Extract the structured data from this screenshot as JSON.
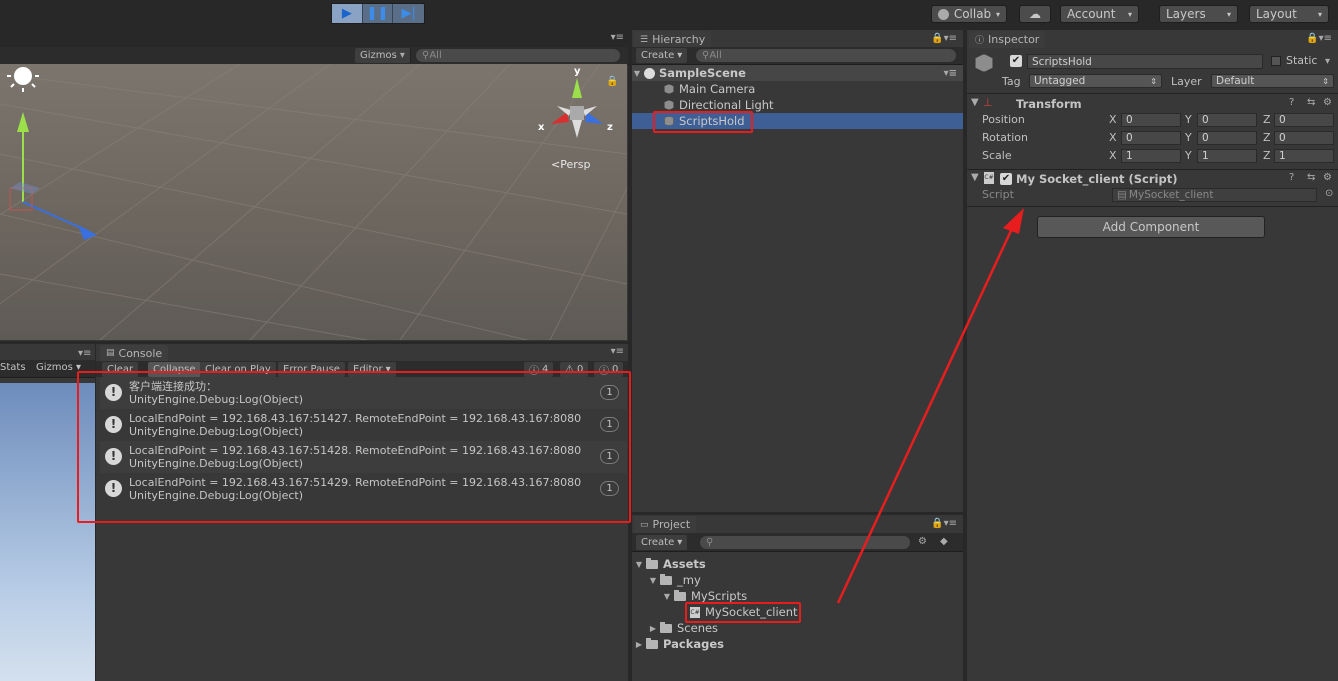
{
  "toolbar": {
    "collab_label": "Collab",
    "account_label": "Account",
    "layers_label": "Layers",
    "layout_label": "Layout"
  },
  "scene": {
    "gizmos_label": "Gizmos",
    "search_placeholder": "All",
    "persp_label": "Persp",
    "axis_y": "y",
    "axis_x": "x",
    "axis_z": "z"
  },
  "game": {
    "stats_label": "Stats",
    "gizmos_label": "Gizmos"
  },
  "hierarchy": {
    "tab_label": "Hierarchy",
    "create_label": "Create",
    "search_placeholder": "All",
    "scene_name": "SampleScene",
    "items": [
      "Main Camera",
      "Directional Light",
      "ScriptsHold"
    ]
  },
  "inspector": {
    "tab_label": "Inspector",
    "object_name": "ScriptsHold",
    "static_label": "Static",
    "tag_label": "Tag",
    "tag_value": "Untagged",
    "layer_label": "Layer",
    "layer_value": "Default",
    "transform": {
      "title": "Transform",
      "rows": [
        {
          "label": "Position",
          "x": "0",
          "y": "0",
          "z": "0"
        },
        {
          "label": "Rotation",
          "x": "0",
          "y": "0",
          "z": "0"
        },
        {
          "label": "Scale",
          "x": "1",
          "y": "1",
          "z": "1"
        }
      ],
      "x_label": "X",
      "y_label": "Y",
      "z_label": "Z"
    },
    "script_component": {
      "title": "My Socket_client (Script)",
      "script_label": "Script",
      "script_value": "MySocket_client"
    },
    "add_component_label": "Add Component"
  },
  "console": {
    "tab_label": "Console",
    "clear_label": "Clear",
    "collapse_label": "Collapse",
    "clear_on_play_label": "Clear on Play",
    "error_pause_label": "Error Pause",
    "editor_label": "Editor",
    "count_log": "4",
    "count_warn": "0",
    "count_err": "0",
    "entries": [
      {
        "line1": "客户端连接成功：",
        "line2": "UnityEngine.Debug:Log(Object)",
        "count": "1"
      },
      {
        "line1": "LocalEndPoint = 192.168.43.167:51427. RemoteEndPoint = 192.168.43.167:8080",
        "line2": "UnityEngine.Debug:Log(Object)",
        "count": "1"
      },
      {
        "line1": "LocalEndPoint = 192.168.43.167:51428. RemoteEndPoint = 192.168.43.167:8080",
        "line2": "UnityEngine.Debug:Log(Object)",
        "count": "1"
      },
      {
        "line1": "LocalEndPoint = 192.168.43.167:51429. RemoteEndPoint = 192.168.43.167:8080",
        "line2": "UnityEngine.Debug:Log(Object)",
        "count": "1"
      }
    ]
  },
  "project": {
    "tab_label": "Project",
    "create_label": "Create",
    "tree": {
      "assets": "Assets",
      "my": "_my",
      "myscripts": "MyScripts",
      "script": "MySocket_client",
      "scenes": "Scenes",
      "packages": "Packages"
    }
  },
  "annotation": {
    "color": "#e81e1e"
  }
}
